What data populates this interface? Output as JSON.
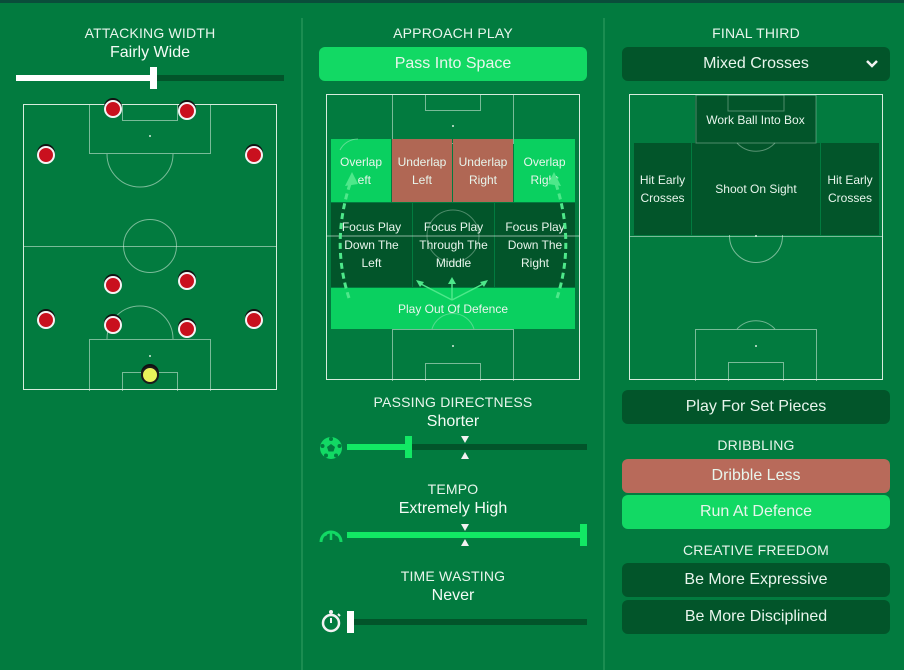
{
  "colors": {
    "background": "#027b3f",
    "selected_green": "#12d964",
    "dark_green": "#02552a",
    "red_selected": "#b86a5a",
    "player_red": "#c9101e",
    "goalkeeper_yellow": "#e8f45a"
  },
  "attacking_width": {
    "title": "ATTACKING WIDTH",
    "value": "Fairly Wide",
    "slider_level_percent": 50,
    "players": [
      {
        "role": "striker-left"
      },
      {
        "role": "striker-right"
      },
      {
        "role": "winger-left"
      },
      {
        "role": "winger-right"
      },
      {
        "role": "mid-left"
      },
      {
        "role": "mid-right"
      },
      {
        "role": "fullback-left"
      },
      {
        "role": "centreback-left"
      },
      {
        "role": "centreback-right"
      },
      {
        "role": "fullback-right"
      },
      {
        "role": "goalkeeper"
      }
    ]
  },
  "approach_play": {
    "title": "APPROACH PLAY",
    "selected_button": "Pass Into Space",
    "zones": {
      "overlap_left": "Overlap Left",
      "underlap_left": "Underlap Left",
      "underlap_right": "Underlap Right",
      "overlap_right": "Overlap Right",
      "focus_left": "Focus Play Down The Left",
      "focus_middle": "Focus Play Through The Middle",
      "focus_right": "Focus Play Down The Right",
      "play_out": "Play Out Of Defence"
    }
  },
  "passing_directness": {
    "title": "PASSING DIRECTNESS",
    "value": "Shorter",
    "icon": "football-icon",
    "slider_level_percent": 24
  },
  "tempo": {
    "title": "TEMPO",
    "value": "Extremely High",
    "icon": "speedometer-icon",
    "slider_level_percent": 100
  },
  "time_wasting": {
    "title": "TIME WASTING",
    "value": "Never",
    "icon": "stopwatch-icon",
    "slider_level_percent": 0
  },
  "final_third": {
    "title": "FINAL THIRD",
    "dropdown_value": "Mixed Crosses",
    "zones": {
      "work_ball": "Work Ball Into Box",
      "hit_early_left": "Hit Early Crosses",
      "shoot_on_sight": "Shoot On Sight",
      "hit_early_right": "Hit Early Crosses"
    },
    "set_pieces_button": "Play For Set Pieces"
  },
  "dribbling": {
    "title": "DRIBBLING",
    "options": [
      "Dribble Less",
      "Run At Defence"
    ]
  },
  "creative_freedom": {
    "title": "CREATIVE FREEDOM",
    "options": [
      "Be More Expressive",
      "Be More Disciplined"
    ]
  }
}
